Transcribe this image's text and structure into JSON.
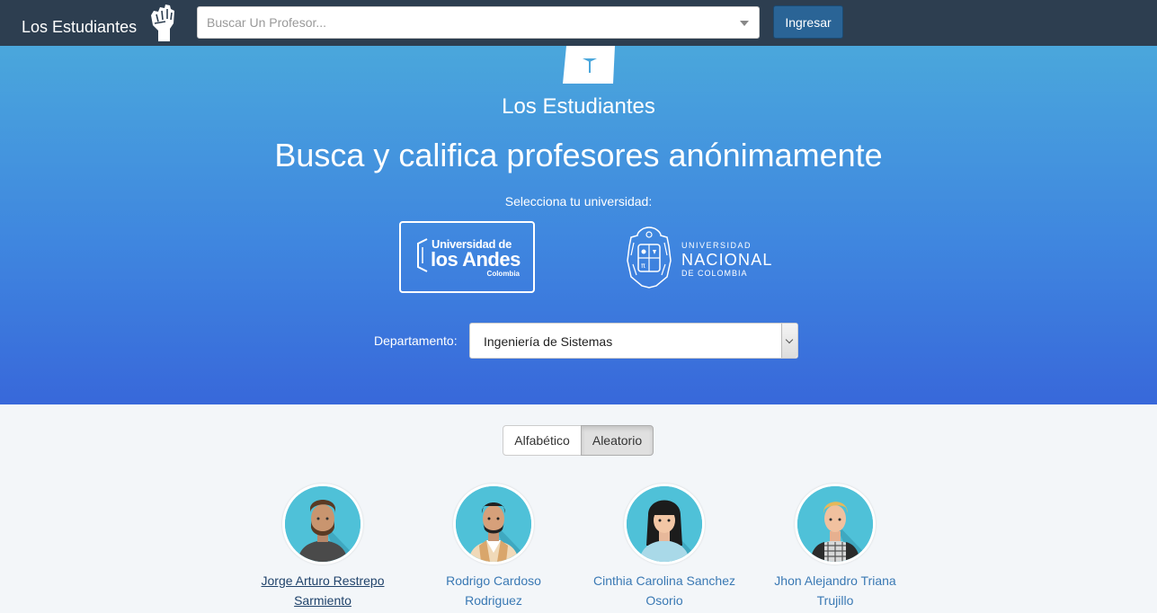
{
  "navbar": {
    "brand": "Los Estudiantes",
    "brand_icon": "raised-fist-icon",
    "search_placeholder": "Buscar Un Profesor...",
    "login_label": "Ingresar"
  },
  "hero": {
    "title": "Los Estudiantes",
    "headline": "Busca y califica profesores anónimamente",
    "select_university": "Selecciona tu universidad:",
    "universities": [
      {
        "line1": "Universidad de",
        "line2": "los Andes",
        "line3": "Colombia"
      },
      {
        "line1": "UNIVERSIDAD",
        "line2": "NACIONAL",
        "line3": "DE COLOMBIA"
      }
    ],
    "department_label": "Departamento:",
    "department_value": "Ingeniería de Sistemas"
  },
  "sort": {
    "alphabetic": "Alfabético",
    "random": "Aleatorio",
    "selected": "Aleatorio"
  },
  "professors": [
    {
      "name_line1": "Jorge Arturo Restrepo",
      "name_line2": "Sarmiento"
    },
    {
      "name_line1": "Rodrigo Cardoso",
      "name_line2": "Rodriguez"
    },
    {
      "name_line1": "Cinthia Carolina Sanchez",
      "name_line2": "Osorio"
    },
    {
      "name_line1": "Jhon Alejandro Triana",
      "name_line2": "Trujillo"
    }
  ],
  "colors": {
    "navbar": "#2d3e50",
    "hero_top": "#4aa7dc",
    "hero_bottom": "#3868da",
    "link": "#3a79b4",
    "avatar_bg": "#4fc1d8"
  }
}
